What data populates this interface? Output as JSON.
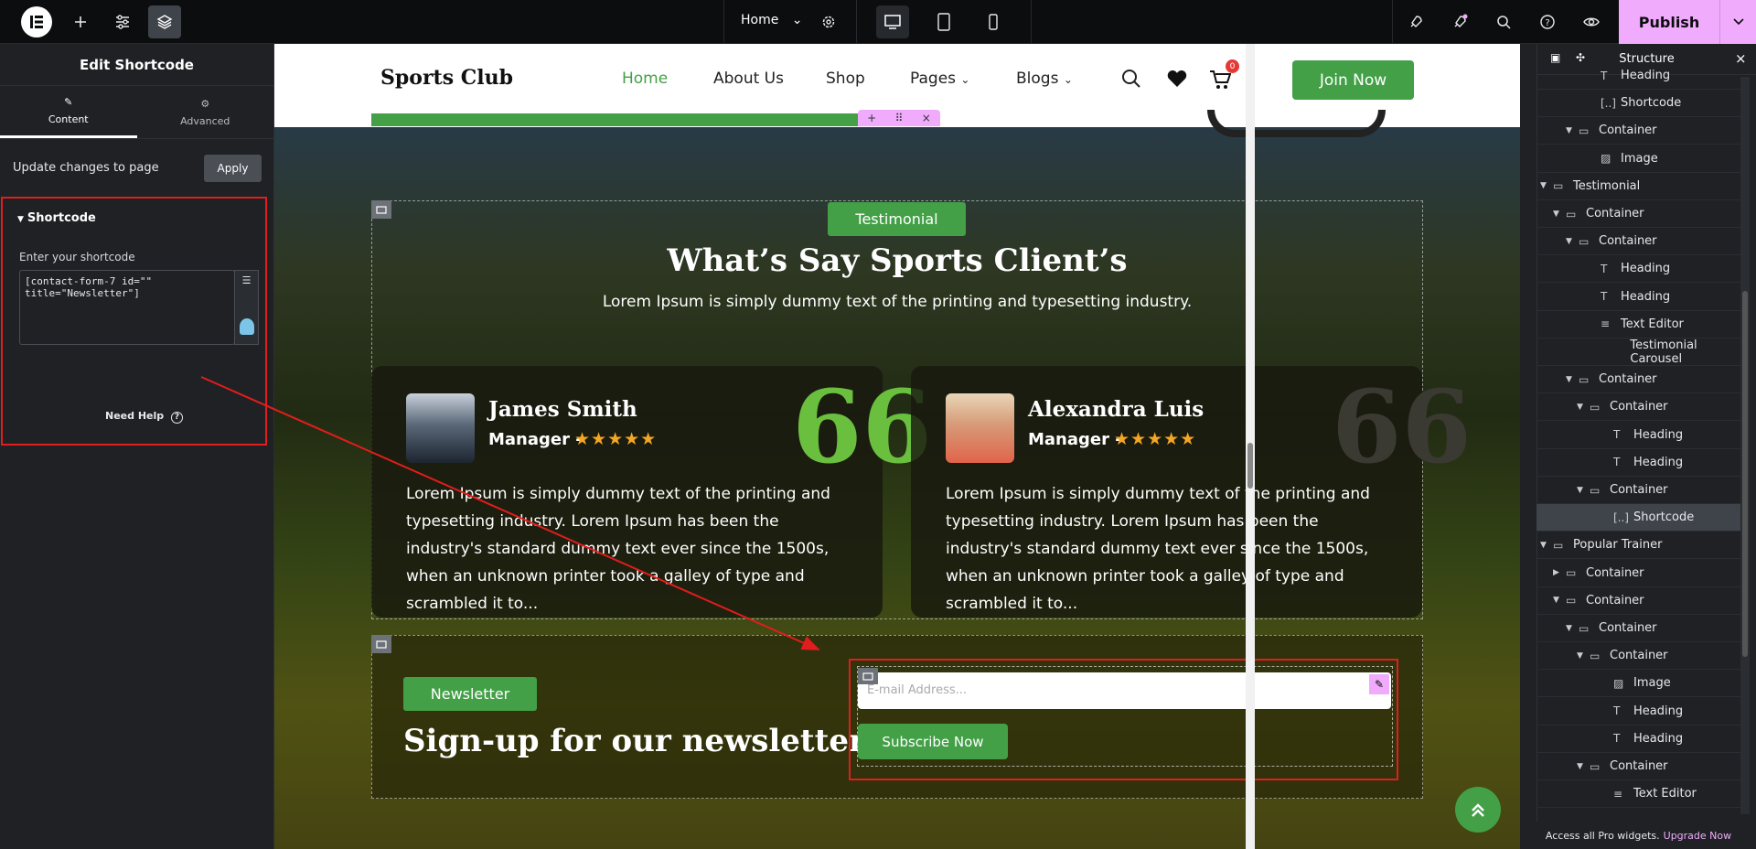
{
  "topbar": {
    "page_name": "Home",
    "publish_label": "Publish"
  },
  "left_panel": {
    "title": "Edit Shortcode",
    "tab_content": "Content",
    "tab_advanced": "Advanced",
    "update_text": "Update changes to page",
    "apply_label": "Apply",
    "section_title": "Shortcode",
    "field_label": "Enter your shortcode",
    "shortcode_value": "[contact-form-7 id=\"\" title=\"Newsletter\"]",
    "need_help": "Need Help"
  },
  "site": {
    "brand": "Sports Club",
    "nav": [
      "Home",
      "About Us",
      "Shop",
      "Pages",
      "Blogs"
    ],
    "cart_count": "0",
    "join_label": "Join Now",
    "testimonial_badge": "Testimonial",
    "testimonial_heading": "What’s Say Sports Client’s",
    "testimonial_sub": "Lorem Ipsum is simply dummy text of the printing and typesetting industry.",
    "cards": [
      {
        "name": "James Smith",
        "role": "Manager -",
        "stars": "★★★★★",
        "quote": "66",
        "quote_color": "#6abf3f",
        "text": "Lorem Ipsum is simply dummy text of the printing and typesetting industry. Lorem Ipsum has been the industry's standard dummy text ever since the 1500s, when an unknown printer took a galley of type and scrambled it to..."
      },
      {
        "name": "Alexandra Luis",
        "role": "Manager -",
        "stars": "★★★★★",
        "quote": "66",
        "quote_color": "#3a3a32",
        "text": "Lorem Ipsum is simply dummy text of the printing and typesetting industry. Lorem Ipsum has been the industry's standard dummy text ever since the 1500s, when an unknown printer took a galley of type and scrambled it to..."
      }
    ],
    "newsletter_badge": "Newsletter",
    "newsletter_heading": "Sign-up for our newsletter",
    "email_placeholder": "E-mail Address...",
    "subscribe_label": "Subscribe Now"
  },
  "structure": {
    "title": "Structure",
    "footer_text": "Access all Pro widgets.",
    "upgrade_label": "Upgrade Now",
    "items": [
      {
        "label": "Heading",
        "icon": "T",
        "caret": ""
      },
      {
        "label": "Shortcode",
        "icon": "[..]",
        "caret": ""
      },
      {
        "label": "Container",
        "icon": "▭",
        "caret": "▼"
      },
      {
        "label": "Image",
        "icon": "▨",
        "caret": ""
      },
      {
        "label": "Testimonial",
        "icon": "▭",
        "caret": "▼"
      },
      {
        "label": "Container",
        "icon": "▭",
        "caret": "▼"
      },
      {
        "label": "Container",
        "icon": "▭",
        "caret": "▼"
      },
      {
        "label": "Heading",
        "icon": "T",
        "caret": ""
      },
      {
        "label": "Heading",
        "icon": "T",
        "caret": ""
      },
      {
        "label": "Text Editor",
        "icon": "≡",
        "caret": ""
      },
      {
        "label": "Testimonial Carousel",
        "icon": "",
        "caret": ""
      },
      {
        "label": "Container",
        "icon": "▭",
        "caret": "▼"
      },
      {
        "label": "Container",
        "icon": "▭",
        "caret": "▼"
      },
      {
        "label": "Heading",
        "icon": "T",
        "caret": ""
      },
      {
        "label": "Heading",
        "icon": "T",
        "caret": ""
      },
      {
        "label": "Container",
        "icon": "▭",
        "caret": "▼"
      },
      {
        "label": "Shortcode",
        "icon": "[..]",
        "caret": ""
      },
      {
        "label": "Popular Trainer",
        "icon": "▭",
        "caret": "▼"
      },
      {
        "label": "Container",
        "icon": "▭",
        "caret": "▶"
      },
      {
        "label": "Container",
        "icon": "▭",
        "caret": "▼"
      },
      {
        "label": "Container",
        "icon": "▭",
        "caret": "▼"
      },
      {
        "label": "Container",
        "icon": "▭",
        "caret": "▼"
      },
      {
        "label": "Image",
        "icon": "▨",
        "caret": ""
      },
      {
        "label": "Heading",
        "icon": "T",
        "caret": ""
      },
      {
        "label": "Heading",
        "icon": "T",
        "caret": ""
      },
      {
        "label": "Container",
        "icon": "▭",
        "caret": "▼"
      },
      {
        "label": "Text Editor",
        "icon": "≡",
        "caret": ""
      }
    ]
  }
}
